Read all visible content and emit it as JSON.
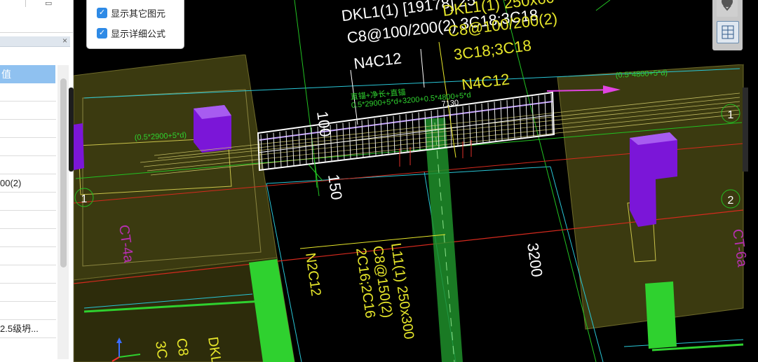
{
  "left_panel": {
    "column_header": "值",
    "rows": [
      "",
      "",
      "",
      "",
      "",
      "00(2)",
      "",
      "",
      "",
      "",
      "",
      "",
      "",
      "2.5级坍..."
    ]
  },
  "options": {
    "show_other_elements": "显示其它图元",
    "show_detailed_formula": "显示详细公式"
  },
  "cad": {
    "beam_label_line1": "DKL1(1) [19178] 25",
    "beam_label_line2": "C8@100/200(2) 3C18;3C18",
    "beam_label_line3": "N4C12",
    "beam_label_yellow_1": "DKL1(1) 250x60",
    "beam_label_yellow_2": "C8@100/200(2)",
    "beam_label_yellow_3": "3C18;3C18",
    "beam_label_yellow_4": "N4C12",
    "anchor_formula_top": "直锚+净长+直锚",
    "anchor_formula_detail": "0.5*2900+5*d+3200+0.5*4800+5*d",
    "anchor_length": "7130",
    "right_formula": "(0.5*4800+5*d)",
    "left_formula": "(0.5*2900+5*d)",
    "dim_100": "100",
    "dim_150": "150",
    "dim_3200": "3200",
    "l11_line1": "L11(1) 250x300",
    "l11_line2": "C8@150(2)",
    "l11_line3": "2C16;2C16",
    "l11_line4": "N2C12",
    "ct_left": "CT-4a",
    "ct_right": "CT-6a",
    "axis_1_right": "1",
    "axis_2_right": "2",
    "axis_1_left": "1",
    "bottom_dkl": "DKL",
    "bottom_c8": "C8",
    "bottom_3c": "3C"
  },
  "colors": {
    "accent_blue": "#2e8ae6",
    "header_blue": "#8fc1f0",
    "cad_background": "#000000",
    "slab_fill": "#3b3a10",
    "column_purple": "#7b16d8",
    "column_green": "#2fd12f",
    "label_yellow": "#e6e62a",
    "rebar_white": "#ffffff"
  },
  "icons": [
    "checkbox-checked-icon",
    "close-icon",
    "grid-view-icon",
    "axis-gizmo-icon"
  ]
}
